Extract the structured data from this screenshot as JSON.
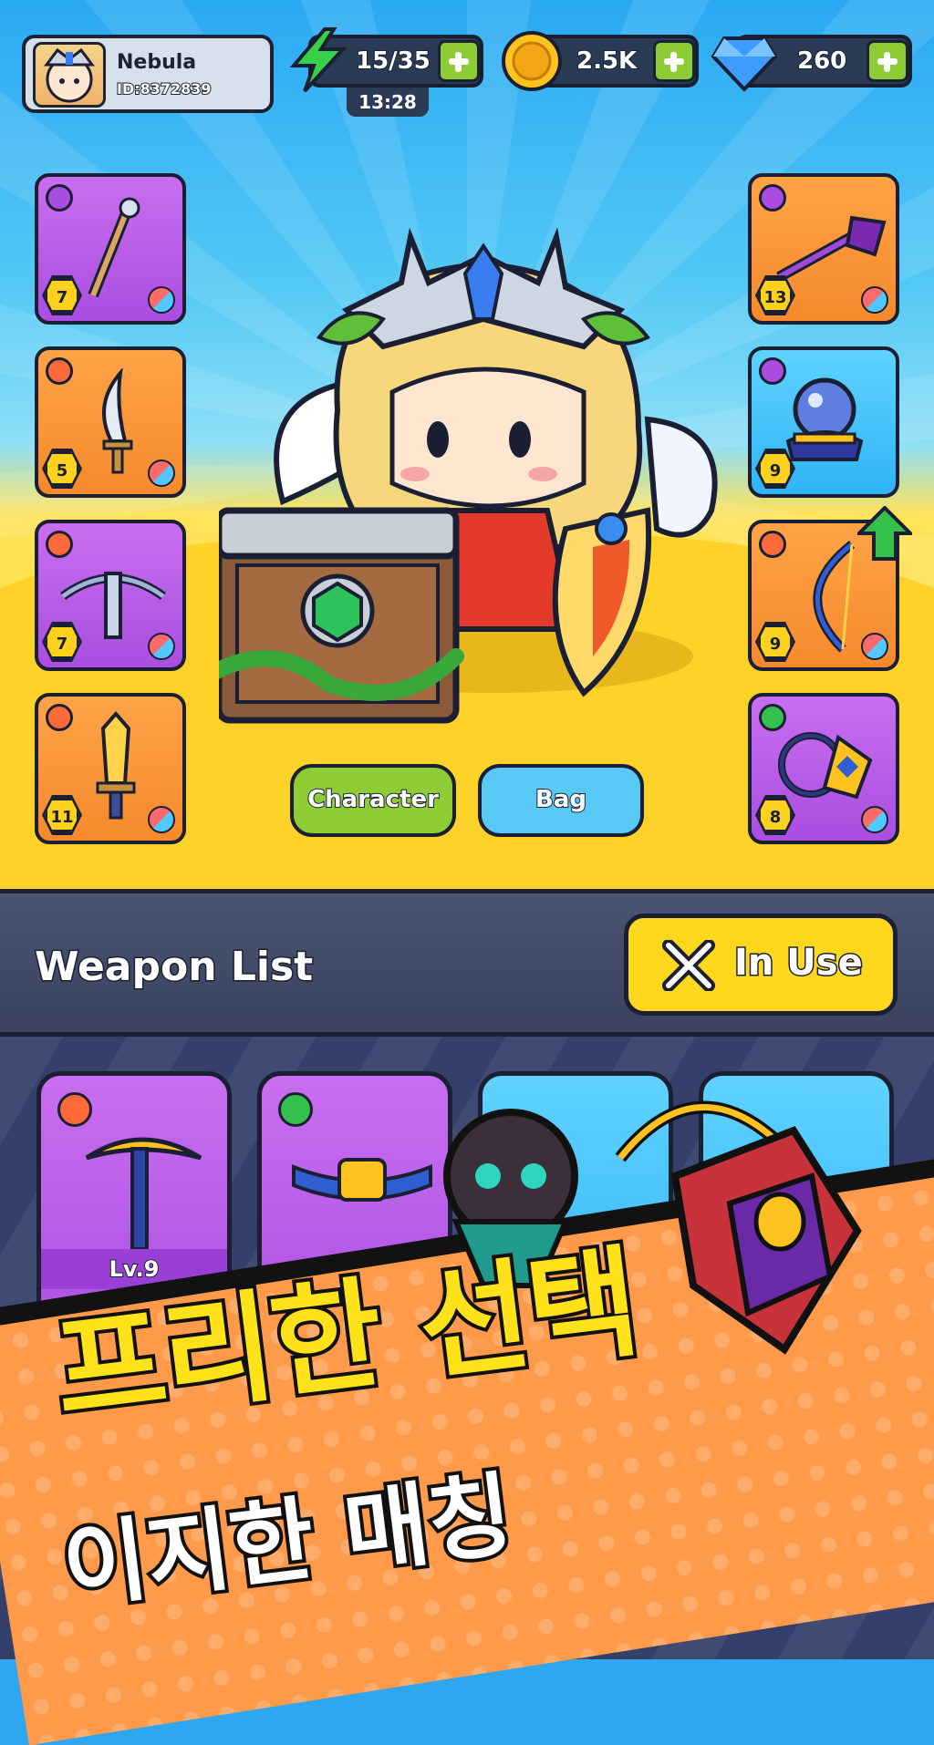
{
  "profile": {
    "name": "Nebula",
    "id": "ID:8372839"
  },
  "resources": {
    "energy": {
      "value": "15/35",
      "timer": "13:28"
    },
    "gold": {
      "value": "2.5K"
    },
    "gems": {
      "value": "260"
    }
  },
  "equipment": {
    "left": [
      {
        "level": "7",
        "color": "purple",
        "icon": "staff-icon"
      },
      {
        "level": "5",
        "color": "orange",
        "icon": "dagger-icon"
      },
      {
        "level": "7",
        "color": "purple",
        "icon": "crossbow-icon"
      },
      {
        "level": "11",
        "color": "orange",
        "icon": "sword-icon"
      }
    ],
    "right": [
      {
        "level": "13",
        "color": "orange",
        "icon": "scepter-icon"
      },
      {
        "level": "9",
        "color": "blue",
        "icon": "crystal-ball-icon"
      },
      {
        "level": "9",
        "color": "orange",
        "icon": "bow-icon"
      },
      {
        "level": "8",
        "color": "purple",
        "icon": "amulet-icon"
      }
    ]
  },
  "buttons": {
    "character": "Character",
    "bag": "Bag",
    "in_use": "In Use"
  },
  "weapon_list": {
    "title": "Weapon List",
    "cards": [
      {
        "level": "Lv.9",
        "icon": "pickaxe-icon"
      },
      {
        "icon": "belt-icon"
      }
    ]
  },
  "promo": {
    "line1": "프리한 선택",
    "line2": "이지한 매칭"
  },
  "colors": {
    "accent_yellow": "#ffd81e",
    "green": "#8dcc35",
    "sky": "#2aa9f3"
  }
}
